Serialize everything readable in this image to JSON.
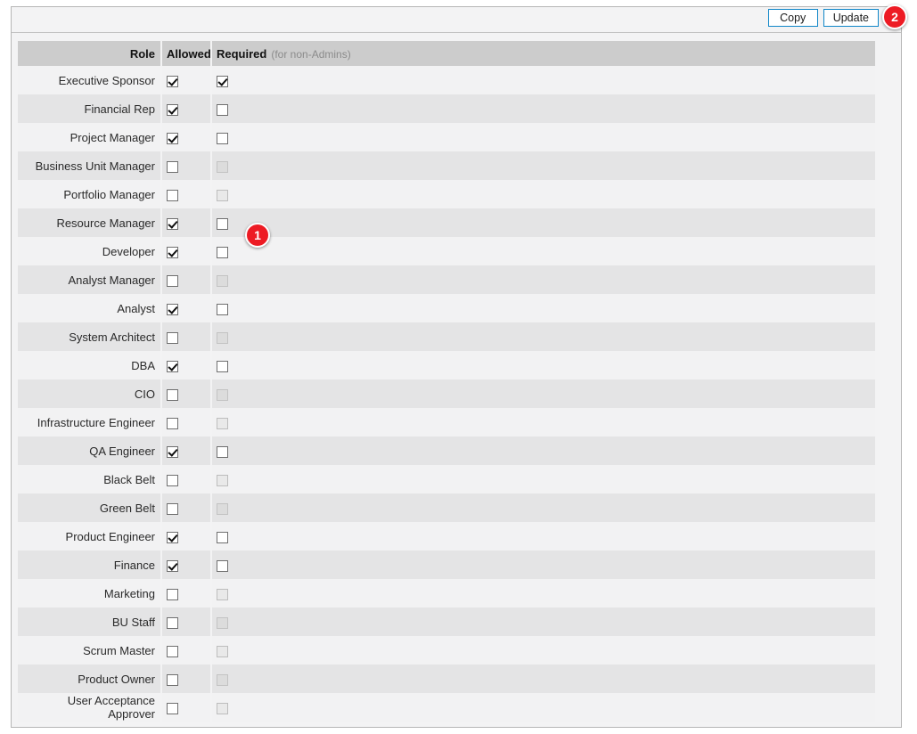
{
  "toolbar": {
    "copy_label": "Copy",
    "update_label": "Update"
  },
  "table": {
    "headers": {
      "role": "Role",
      "allowed": "Allowed",
      "required": "Required",
      "required_note": "(for non-Admins)"
    },
    "rows": [
      {
        "role": "Executive Sponsor",
        "allowed": true,
        "required": true,
        "required_disabled": false
      },
      {
        "role": "Financial Rep",
        "allowed": true,
        "required": false,
        "required_disabled": false
      },
      {
        "role": "Project Manager",
        "allowed": true,
        "required": false,
        "required_disabled": false
      },
      {
        "role": "Business Unit Manager",
        "allowed": false,
        "required": false,
        "required_disabled": true
      },
      {
        "role": "Portfolio Manager",
        "allowed": false,
        "required": false,
        "required_disabled": true
      },
      {
        "role": "Resource Manager",
        "allowed": true,
        "required": false,
        "required_disabled": false
      },
      {
        "role": "Developer",
        "allowed": true,
        "required": false,
        "required_disabled": false
      },
      {
        "role": "Analyst Manager",
        "allowed": false,
        "required": false,
        "required_disabled": true
      },
      {
        "role": "Analyst",
        "allowed": true,
        "required": false,
        "required_disabled": false
      },
      {
        "role": "System Architect",
        "allowed": false,
        "required": false,
        "required_disabled": true
      },
      {
        "role": "DBA",
        "allowed": true,
        "required": false,
        "required_disabled": false
      },
      {
        "role": "CIO",
        "allowed": false,
        "required": false,
        "required_disabled": true
      },
      {
        "role": "Infrastructure Engineer",
        "allowed": false,
        "required": false,
        "required_disabled": true
      },
      {
        "role": "QA Engineer",
        "allowed": true,
        "required": false,
        "required_disabled": false
      },
      {
        "role": "Black Belt",
        "allowed": false,
        "required": false,
        "required_disabled": true
      },
      {
        "role": "Green Belt",
        "allowed": false,
        "required": false,
        "required_disabled": true
      },
      {
        "role": "Product Engineer",
        "allowed": true,
        "required": false,
        "required_disabled": false
      },
      {
        "role": "Finance",
        "allowed": true,
        "required": false,
        "required_disabled": false
      },
      {
        "role": "Marketing",
        "allowed": false,
        "required": false,
        "required_disabled": true
      },
      {
        "role": "BU Staff",
        "allowed": false,
        "required": false,
        "required_disabled": true
      },
      {
        "role": "Scrum Master",
        "allowed": false,
        "required": false,
        "required_disabled": true
      },
      {
        "role": "Product Owner",
        "allowed": false,
        "required": false,
        "required_disabled": true
      },
      {
        "role": "User Acceptance Approver",
        "allowed": false,
        "required": false,
        "required_disabled": true
      }
    ]
  },
  "annotations": {
    "badge_1": "1",
    "badge_2": "2",
    "color": "#ed1b24"
  }
}
